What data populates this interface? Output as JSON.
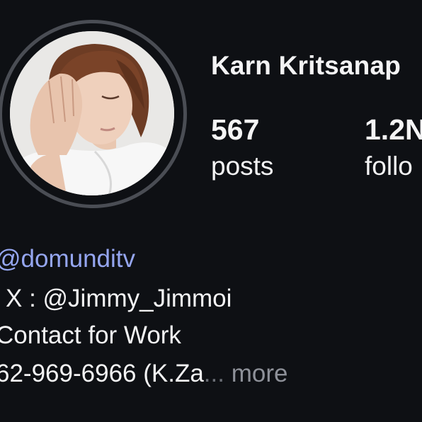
{
  "profile": {
    "name": "Karn Kritsanap",
    "avatar_alt": "profile-photo"
  },
  "stats": [
    {
      "value": "567",
      "label": "posts"
    },
    {
      "value": "1.2N",
      "label": "follo"
    }
  ],
  "bio": {
    "mention": "@domunditv",
    "line2": "X : @Jimmy_Jimmoi",
    "line3": "Contact for Work",
    "line4": "62-969-6966 (K.Za",
    "ellipsis": "...",
    "more": "more"
  }
}
